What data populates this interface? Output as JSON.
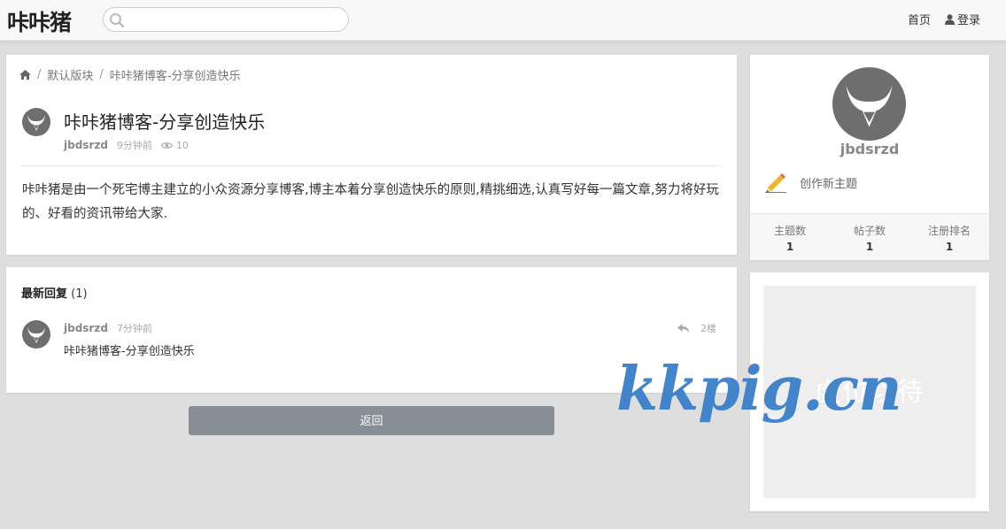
{
  "header": {
    "logo": "咔咔猪",
    "search_placeholder": "",
    "nav_home": "首页",
    "nav_login": "登录"
  },
  "breadcrumb": {
    "section": "默认版块",
    "current": "咔咔猪博客-分享创造快乐"
  },
  "post": {
    "title": "咔咔猪博客-分享创造快乐",
    "author": "jbdsrzd",
    "time": "9分钟前",
    "views": "10",
    "body": "咔咔猪是由一个死宅博主建立的小众资源分享博客,博主本着分享创造快乐的原则,精挑细选,认真写好每一篇文章,努力将好玩的、好看的资讯带给大家."
  },
  "replies": {
    "heading": "最新回复",
    "count": "(1)",
    "items": [
      {
        "author": "jbdsrzd",
        "time": "7分钟前",
        "floor": "2楼",
        "text": "咔咔猪博客-分享创造快乐"
      }
    ]
  },
  "back_button": "返回",
  "profile": {
    "name": "jbdsrzd",
    "create_topic": "创作新主题",
    "stats": [
      {
        "label": "主题数",
        "value": "1"
      },
      {
        "label": "帖子数",
        "value": "1"
      },
      {
        "label": "注册排名",
        "value": "1"
      }
    ]
  },
  "ad": {
    "placeholder": "虚位以待"
  },
  "watermark": "kkpig.cn",
  "colors": {
    "background": "#dedede",
    "button": "#888e96",
    "watermark": "#3b7fc8",
    "avatar": "#6e6e6e"
  }
}
